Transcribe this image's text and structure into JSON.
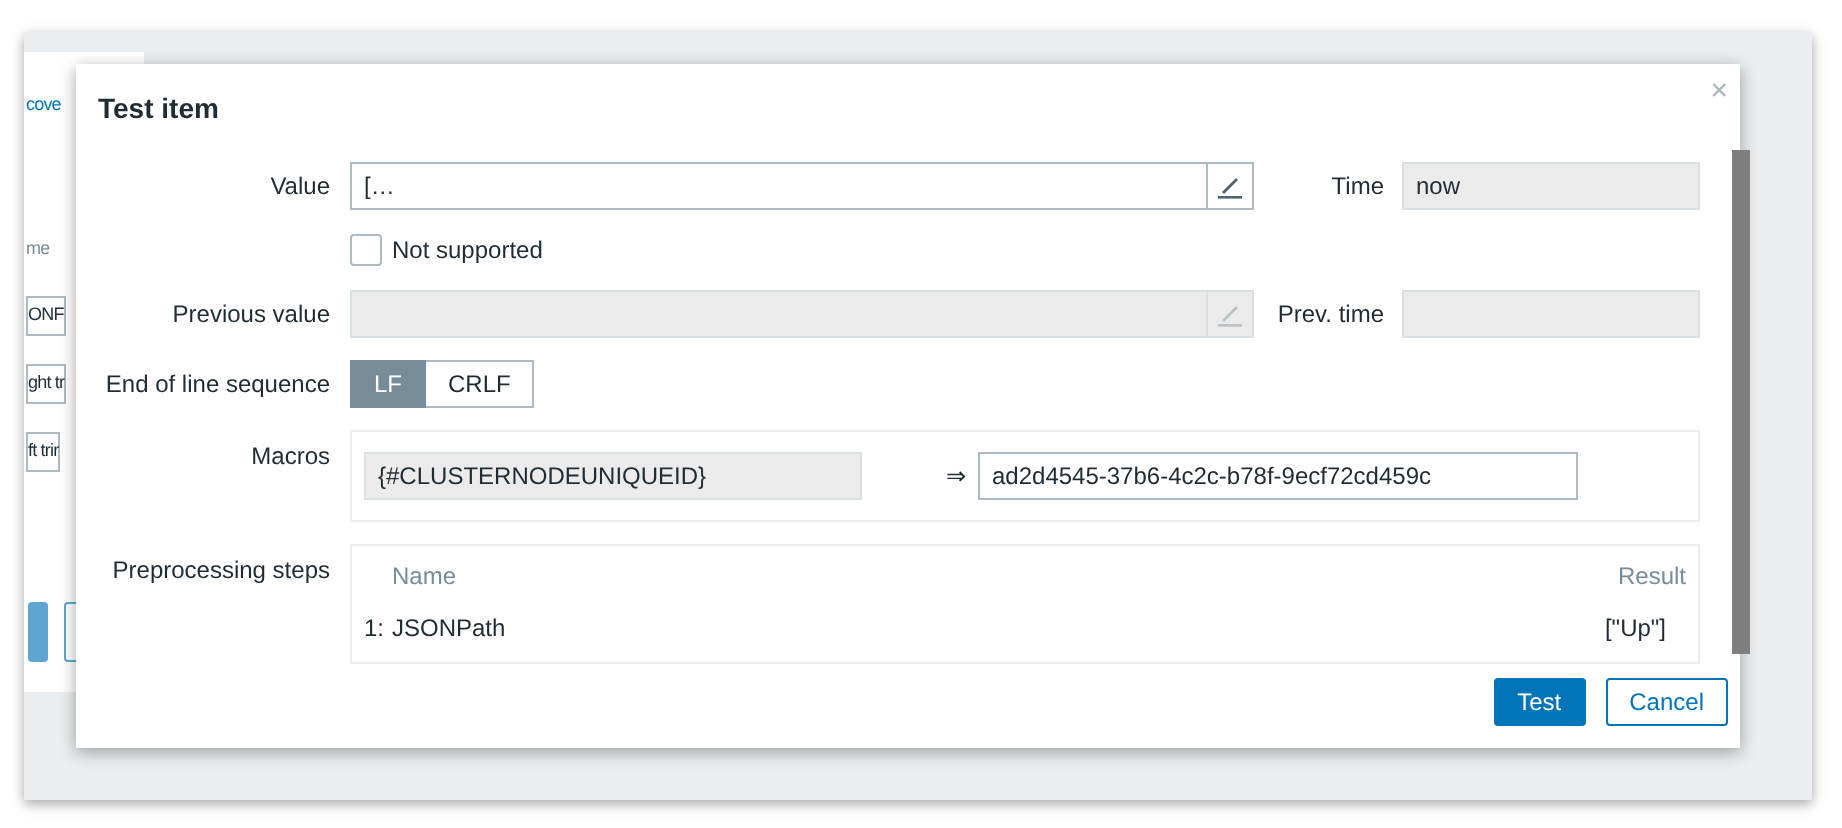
{
  "background": [
    {
      "kind": "link",
      "text": "cove"
    },
    {
      "kind": "label",
      "text": "me"
    },
    {
      "kind": "field",
      "text": "ONF"
    },
    {
      "kind": "field",
      "text": "ght tr"
    },
    {
      "kind": "field",
      "text": "ft trir"
    },
    {
      "kind": "primary-button"
    },
    {
      "kind": "button"
    }
  ],
  "dialog": {
    "title": "Test item",
    "close": "×",
    "value": {
      "label": "Value",
      "value": "[…",
      "disabled": false
    },
    "time": {
      "label": "Time",
      "value": "now",
      "disabled": true
    },
    "not_supported": {
      "label": "Not supported",
      "checked": false
    },
    "previous_value": {
      "label": "Previous value",
      "disabled": true
    },
    "prev_time": {
      "label": "Prev. time",
      "disabled": true
    },
    "eol": {
      "label": "End of line sequence",
      "options": [
        {
          "label": "LF",
          "selected": true
        },
        {
          "label": "CRLF",
          "selected": false
        }
      ]
    },
    "macros": {
      "label": "Macros",
      "items": [
        {
          "macro": "{#CLUSTERNODEUNIQUEID}",
          "arrow": "⇒",
          "value": "ad2d4545-37b6-4c2c-b78f-9ecf72cd459c"
        }
      ]
    },
    "preprocessing": {
      "label": "Preprocessing steps",
      "columns": [
        "Name",
        "Result"
      ],
      "rows": [
        {
          "index": "1:",
          "name": "JSONPath",
          "result": "[\"Up\"]"
        }
      ]
    },
    "buttons": [
      {
        "label": "Test",
        "kind": "primary"
      },
      {
        "label": "Cancel",
        "kind": "secondary"
      }
    ]
  }
}
